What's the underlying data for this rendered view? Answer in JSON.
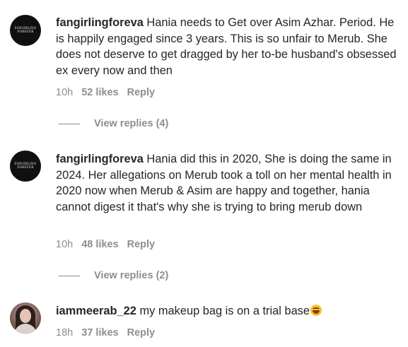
{
  "comments": [
    {
      "username": "fangirlingforeva",
      "avatar_text": "FANGIRLING FOREVER",
      "text": "Hania needs to Get over Asim Azhar. Period. He is happily engaged since 3 years. This is so unfair to Merub. She does not deserve to get dragged by her to-be husband's obsessed ex every now and then",
      "time": "10h",
      "likes": "52 likes",
      "reply": "Reply",
      "view_replies": "View replies (4)"
    },
    {
      "username": "fangirlingforeva",
      "avatar_text": "FANGIRLING FOREVER",
      "text": "Hania did this in 2020, She is doing the same in 2024. Her allegations on Merub took a toll on her mental health in 2020 now when Merub & Asim are happy and together, hania cannot digest it that's why she is trying to bring merub down",
      "time": "10h",
      "likes": "48 likes",
      "reply": "Reply",
      "view_replies": "View replies (2)"
    },
    {
      "username": "iammeerab_22",
      "text": "my makeup bag is on a trial base",
      "emoji": "laughing-emoji",
      "time": "18h",
      "likes": "37 likes",
      "reply": "Reply"
    }
  ]
}
